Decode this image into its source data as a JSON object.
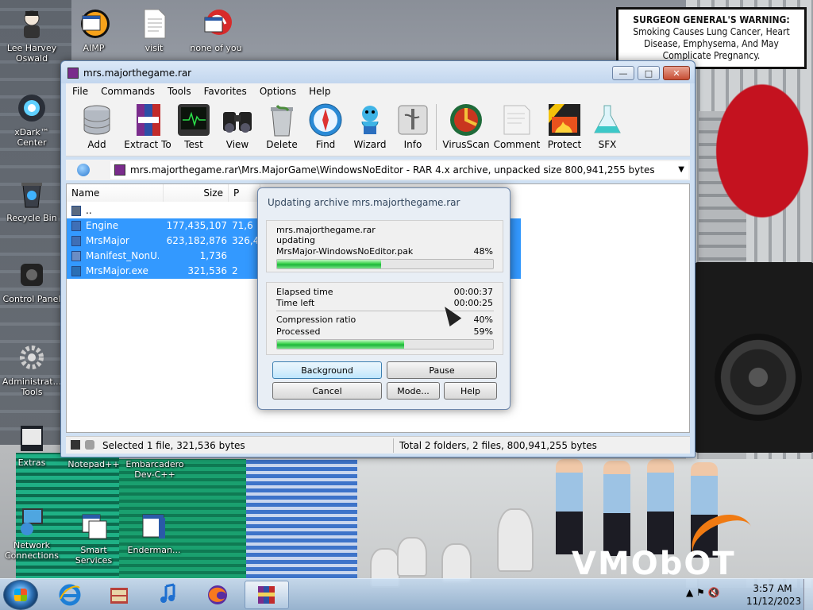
{
  "warning": {
    "heading": "SURGEON GENERAL'S WARNING:",
    "body": "Smoking Causes Lung Cancer, Heart Disease, Emphysema, And May Complicate Pregnancy."
  },
  "background_logo": "VMObOT",
  "desktop_icons": [
    {
      "label": "Lee Harvey Oswald",
      "icon": "person-icon"
    },
    {
      "label": "AIMP",
      "icon": "aimp-shortcut-icon"
    },
    {
      "label": "visit",
      "icon": "document-icon"
    },
    {
      "label": "none of you",
      "icon": "shortcut-icon"
    },
    {
      "label": "xDark™ Center",
      "icon": "xdark-icon"
    },
    {
      "label": "Recycle Bin",
      "icon": "recycle-bin-icon"
    },
    {
      "label": "Control Panel",
      "icon": "control-panel-icon"
    },
    {
      "label": "Administrat... Tools",
      "icon": "admin-tools-icon"
    },
    {
      "label": "Extras",
      "icon": "extras-icon"
    },
    {
      "label": "Notepad++",
      "icon": "notepad-icon"
    },
    {
      "label": "Embarcadero Dev-C++",
      "icon": "devcpp-icon"
    },
    {
      "label": "Network Connections",
      "icon": "network-icon"
    },
    {
      "label": "Smart Services",
      "icon": "services-icon"
    },
    {
      "label": "Enderman...",
      "icon": "shortcut-icon"
    }
  ],
  "window": {
    "title": "mrs.majorthegame.rar",
    "controls": {
      "minimize": "—",
      "maximize": "□",
      "close": "✕"
    },
    "menu": [
      "File",
      "Commands",
      "Tools",
      "Favorites",
      "Options",
      "Help"
    ],
    "toolbar": [
      {
        "label": "Add",
        "icon": "database-icon"
      },
      {
        "label": "Extract To",
        "icon": "books-icon"
      },
      {
        "label": "Test",
        "icon": "monitor-icon"
      },
      {
        "label": "View",
        "icon": "binoculars-icon"
      },
      {
        "label": "Delete",
        "icon": "trash-icon"
      },
      {
        "label": "Find",
        "icon": "compass-icon"
      },
      {
        "label": "Wizard",
        "icon": "wizard-icon"
      },
      {
        "label": "Info",
        "icon": "info-icon"
      },
      {
        "label": "VirusScan",
        "icon": "shield-icon"
      },
      {
        "label": "Comment",
        "icon": "note-icon"
      },
      {
        "label": "Protect",
        "icon": "protect-icon"
      },
      {
        "label": "SFX",
        "icon": "flask-icon"
      }
    ],
    "address": "mrs.majorthegame.rar\\Mrs.MajorGame\\WindowsNoEditor - RAR 4.x archive, unpacked size 800,941,255 bytes",
    "columns": {
      "name": "Name",
      "size": "Size",
      "packed": "P"
    },
    "files": [
      {
        "name": "..",
        "size": "",
        "packed": "",
        "selected": false
      },
      {
        "name": "Engine",
        "size": "177,435,107",
        "packed": "71,6",
        "selected": true
      },
      {
        "name": "MrsMajor",
        "size": "623,182,876",
        "packed": "326,4",
        "selected": true
      },
      {
        "name": "Manifest_NonU...",
        "size": "1,736",
        "packed": "",
        "selected": true
      },
      {
        "name": "MrsMajor.exe",
        "size": "321,536",
        "packed": "2",
        "selected": true
      }
    ],
    "status_left": "Selected 1 file, 321,536 bytes",
    "status_right": "Total 2 folders, 2 files, 800,941,255 bytes"
  },
  "dialog": {
    "title": "Updating archive mrs.majorthegame.rar",
    "archive": "mrs.majorthegame.rar",
    "action": "updating",
    "current_file": "MrsMajor-WindowsNoEditor.pak",
    "file_percent_label": "48%",
    "file_progress": 0.48,
    "elapsed_label": "Elapsed time",
    "elapsed": "00:00:37",
    "left_label": "Time left",
    "left": "00:00:25",
    "ratio_label": "Compression ratio",
    "ratio": "40%",
    "processed_label": "Processed",
    "processed": "59%",
    "processed_progress": 0.59,
    "buttons": {
      "background": "Background",
      "pause": "Pause",
      "cancel": "Cancel",
      "mode": "Mode...",
      "help": "Help"
    }
  },
  "taskbar": {
    "time": "3:57 AM",
    "date": "11/12/2023",
    "tray_glyphs": "▲ ⚑ 🔇"
  }
}
